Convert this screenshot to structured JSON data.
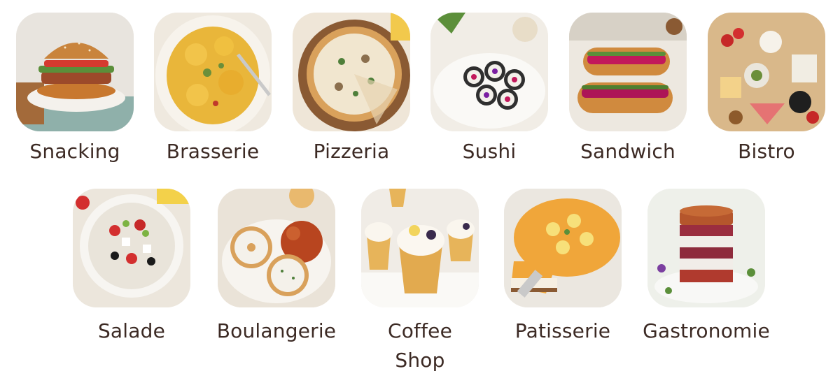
{
  "categories": [
    {
      "label": "Snacking",
      "icon": "burger-image"
    },
    {
      "label": "Brasserie",
      "icon": "pasta-dish-image"
    },
    {
      "label": "Pizzeria",
      "icon": "pizza-image"
    },
    {
      "label": "Sushi",
      "icon": "sushi-rolls-image"
    },
    {
      "label": "Sandwich",
      "icon": "sandwich-image"
    },
    {
      "label": "Bistro",
      "icon": "charcuterie-board-image"
    },
    {
      "label": "Salade",
      "icon": "salad-bowl-image"
    },
    {
      "label": "Boulangerie",
      "icon": "bagel-image"
    },
    {
      "label": "Coffee Shop",
      "icon": "cupcakes-image"
    },
    {
      "label": "Patisserie",
      "icon": "cheesecake-image"
    },
    {
      "label": "Gastronomie",
      "icon": "layered-dessert-image"
    }
  ],
  "colors": {
    "label_text": "#3c2a24",
    "background": "#ffffff"
  }
}
